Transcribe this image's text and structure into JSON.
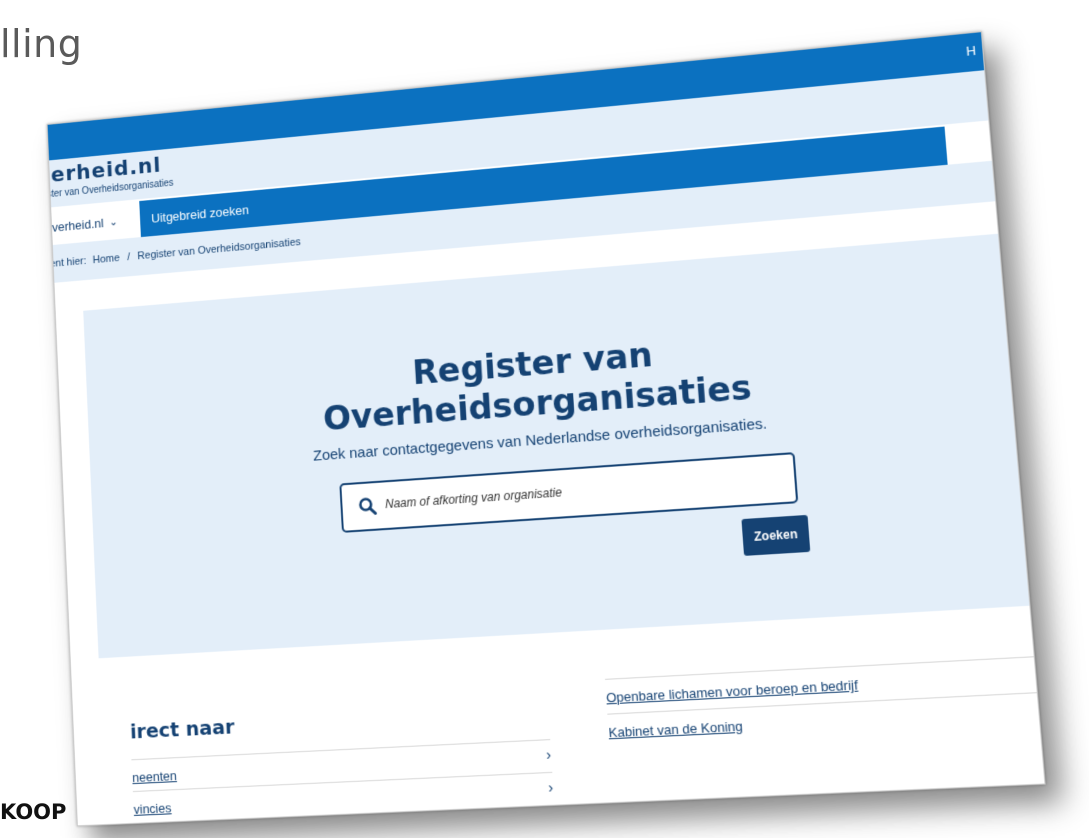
{
  "slide": {
    "title": "lling",
    "footer": "KOOP"
  },
  "site": {
    "top_link": "H",
    "logo": "verheid.nl",
    "logo_sub": "ster van Overheidsorganisaties",
    "nav": {
      "home_label": "verheid.nl",
      "active_tab": "Uitgebreid zoeken"
    },
    "breadcrumb": {
      "prefix": "ent hier:",
      "home": "Home",
      "separator": "/",
      "current": "Register van Overheidsorganisaties"
    },
    "hero": {
      "title_line1": "Register van",
      "title_line2": "Overheidsorganisaties",
      "subtitle": "Zoek naar contactgegevens van Nederlandse overheidsorganisaties.",
      "search_placeholder": "Naam of afkorting van organisatie",
      "search_button": "Zoeken"
    },
    "direct": {
      "title": "irect naar",
      "left_items": [
        "neenten",
        "vincies"
      ],
      "right_items": [
        "Openbare lichamen voor beroep en bedrijf",
        "Kabinet van de Koning"
      ]
    }
  },
  "colors": {
    "primary_blue": "#0b71c0",
    "dark_blue": "#154273",
    "light_blue": "#e3eef9"
  }
}
